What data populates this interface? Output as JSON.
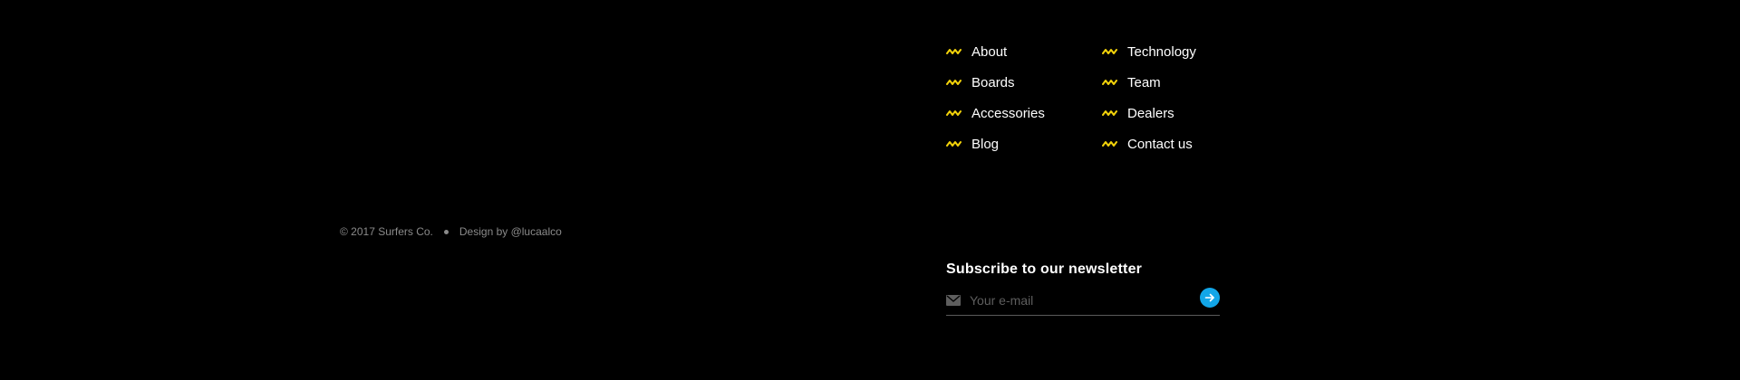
{
  "colors": {
    "background": "#000000",
    "accent_yellow": "#f2d20a",
    "accent_blue": "#12a6e8",
    "muted_text": "#8a8a8a"
  },
  "nav": {
    "icon": "wave-icon",
    "column1": [
      {
        "label": "About"
      },
      {
        "label": "Boards"
      },
      {
        "label": "Accessories"
      },
      {
        "label": "Blog"
      }
    ],
    "column2": [
      {
        "label": "Technology"
      },
      {
        "label": "Team"
      },
      {
        "label": "Dealers"
      },
      {
        "label": "Contact us"
      }
    ]
  },
  "footer": {
    "copyright": "© 2017 Surfers Co.",
    "credit": "Design by @lucaalco"
  },
  "newsletter": {
    "title": "Subscribe to our newsletter",
    "placeholder": "Your e-mail",
    "input_icon": "mail-icon",
    "submit_icon": "arrow-right-icon"
  }
}
